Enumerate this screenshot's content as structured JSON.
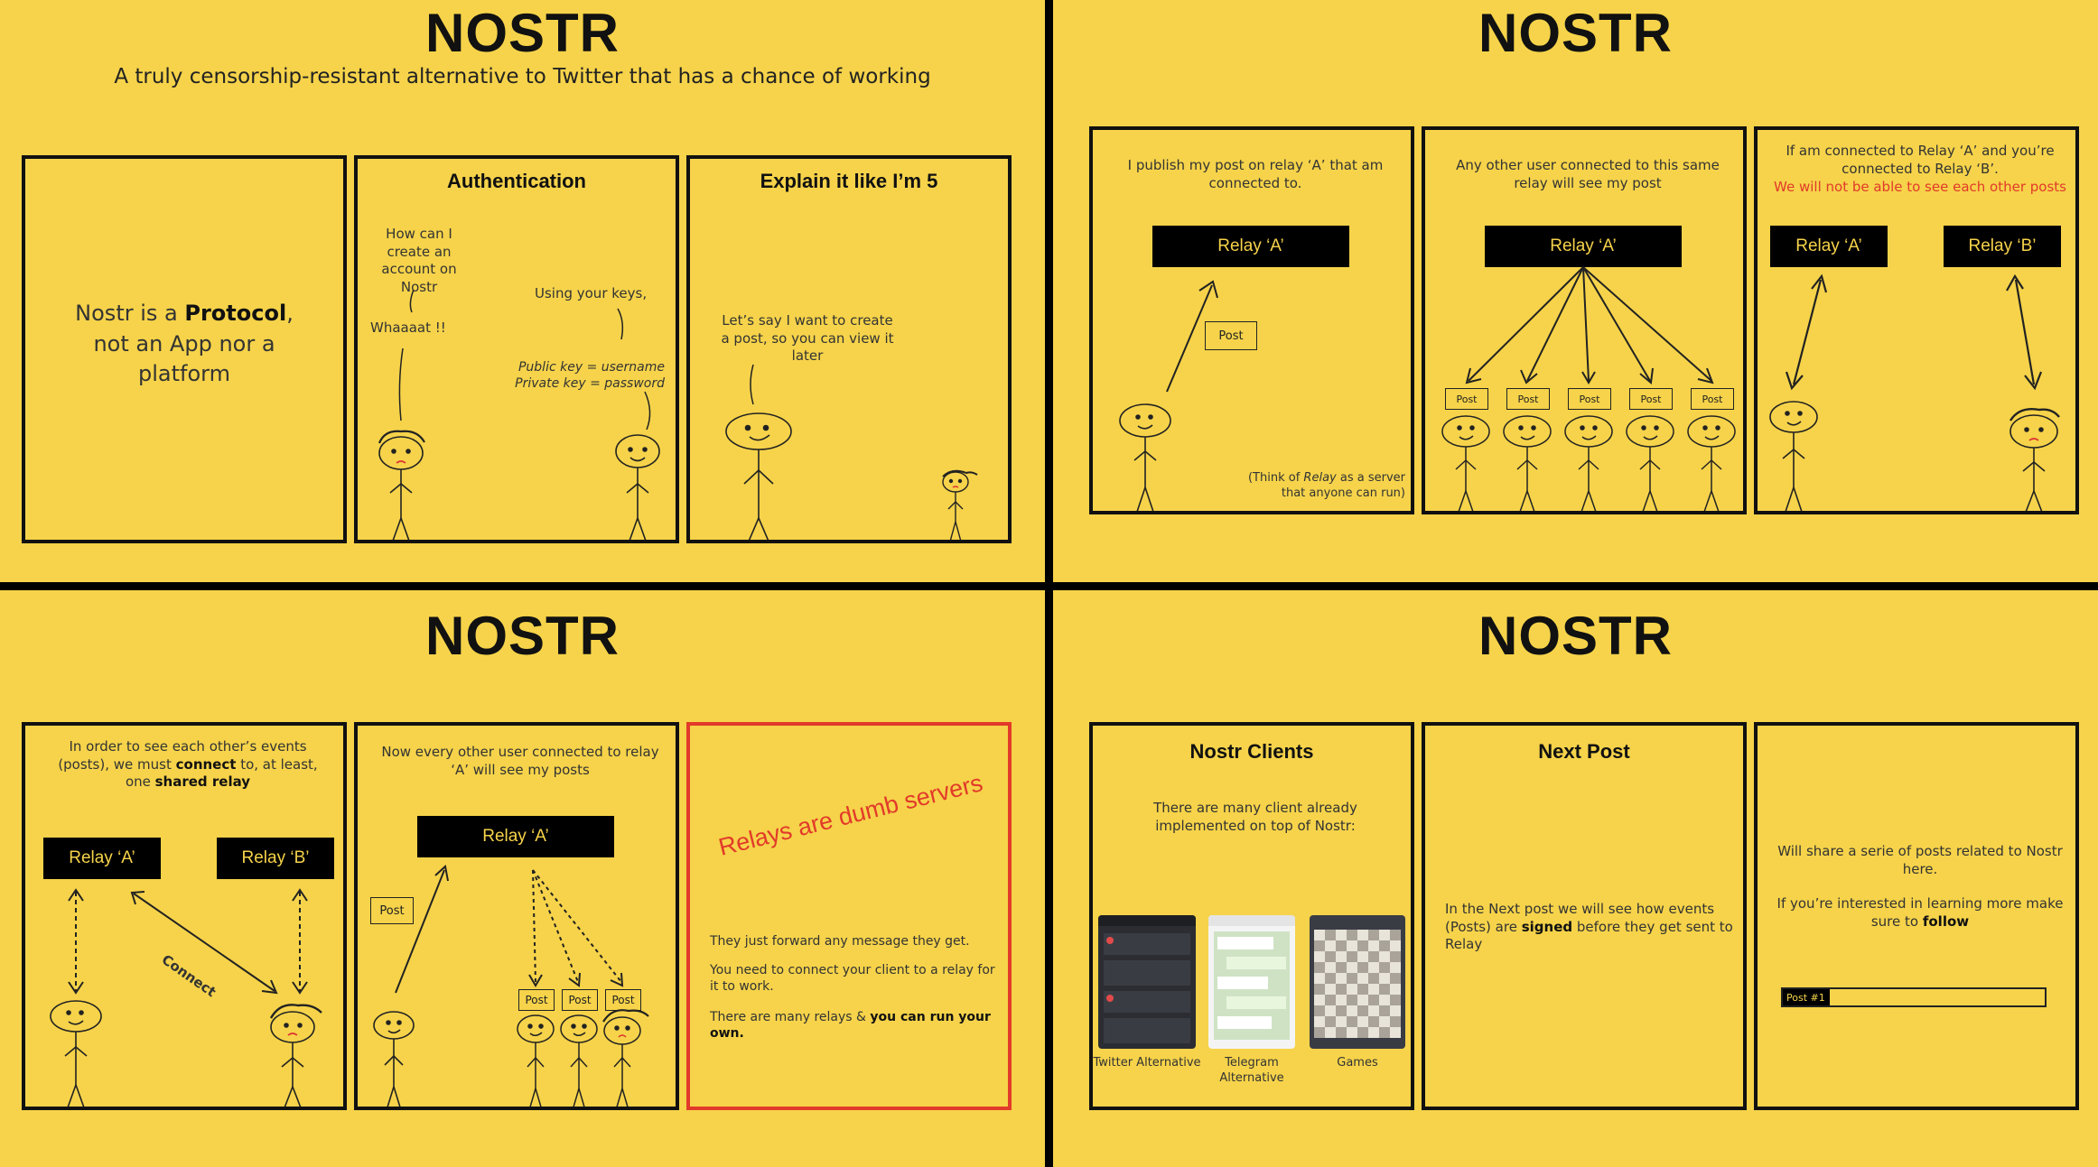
{
  "title": "NOSTR",
  "subtitle": "A truly censorship-resistant alternative to Twitter that has a chance of working",
  "q1": {
    "p1": {
      "pre": "Nostr is a ",
      "bold": "Protocol",
      "post": ", not an App nor a platform"
    },
    "p2": {
      "title": "Authentication",
      "q_create": "How can I create an account on Nostr",
      "whaaat": "Whaaaat !!",
      "using_keys": "Using your keys,",
      "public_key": "Public key = username",
      "private_key": "Private key = password"
    },
    "p3": {
      "title": "Explain it like I’m 5",
      "text": "Let’s say I want to create a post, so you can view it later"
    }
  },
  "q2": {
    "p1": {
      "text": "I publish my post on relay ‘A’ that am connected to.",
      "relay": "Relay ‘A’",
      "post": "Post",
      "note_pre": "(Think of ",
      "note_em": "Relay",
      "note_post": " as a server that anyone can run)"
    },
    "p2": {
      "text": "Any other user connected to this same relay will see my post",
      "relay": "Relay ‘A’",
      "post": "Post"
    },
    "p3": {
      "text": "If am connected to Relay ‘A’ and you’re connected to Relay ‘B’.",
      "warning": "We will not be able to see each other posts",
      "relay_a": "Relay ‘A’",
      "relay_b": "Relay ‘B’"
    }
  },
  "q3": {
    "p1": {
      "t1": "In order to see each other’s events (posts), we must ",
      "t_connect": "connect",
      "t2": " to, at least, one ",
      "t_shared": "shared relay",
      "relay_a": "Relay ‘A’",
      "relay_b": "Relay ‘B’",
      "connect_label": "Connect"
    },
    "p2": {
      "text": "Now every other user connected to relay ‘A’ will see my posts",
      "relay": "Relay ‘A’",
      "post": "Post"
    },
    "p3": {
      "headline": "Relays are dumb servers",
      "l1": "They just forward any message they get.",
      "l2": "You need to connect your client to a relay for it to work.",
      "l3_pre": "There are many relays & ",
      "l3_bold": "you can run your own."
    }
  },
  "q4": {
    "p1": {
      "title": "Nostr Clients",
      "text": "There are many client already implemented on top of Nostr:",
      "c1": "Twitter Alternative",
      "c2": "Telegram Alternative",
      "c3": "Games"
    },
    "p2": {
      "title": "Next Post",
      "t1": "In the Next post we will see how events (Posts) are ",
      "t_bold": "signed",
      "t2": " before they get sent to Relay"
    },
    "p3": {
      "t1": "Will share a serie of posts related to Nostr here.",
      "t2": "If you’re interested in learning more make sure to ",
      "t_bold": "follow",
      "bar_label": "Post #1",
      "progress": 0.18
    }
  },
  "colors": {
    "background": "#f6d34a",
    "ink": "#111111",
    "accent_red": "#e23a2a"
  }
}
